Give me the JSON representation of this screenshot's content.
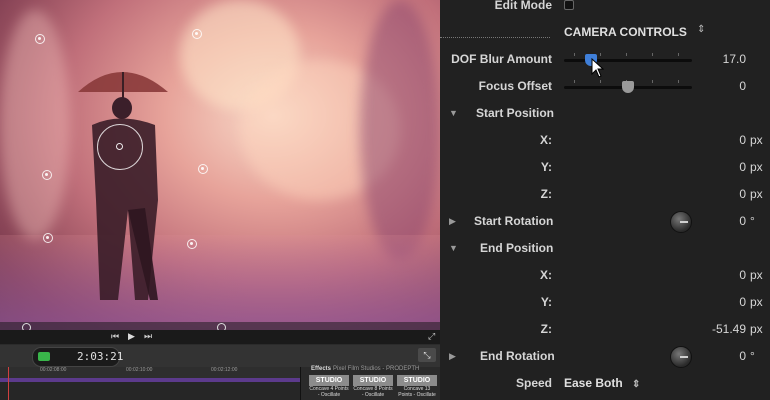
{
  "panel": {
    "edit_mode_label": "Edit Mode",
    "section_title": "CAMERA CONTROLS",
    "dof_blur_label": "DOF Blur Amount",
    "dof_blur_value": "17.0",
    "dof_blur_level": 0.18,
    "focus_offset_label": "Focus Offset",
    "focus_offset_value": "0",
    "focus_offset_level": 0.5,
    "start_position_label": "Start Position",
    "start_x_label": "X:",
    "start_x_value": "0",
    "start_x_unit": "px",
    "start_y_label": "Y:",
    "start_y_value": "0",
    "start_y_unit": "px",
    "start_z_label": "Z:",
    "start_z_value": "0",
    "start_z_unit": "px",
    "start_rotation_label": "Start Rotation",
    "start_rotation_value": "0",
    "start_rotation_unit": "°",
    "end_position_label": "End Position",
    "end_x_label": "X:",
    "end_x_value": "0",
    "end_x_unit": "px",
    "end_y_label": "Y:",
    "end_y_value": "0",
    "end_y_unit": "px",
    "end_z_label": "Z:",
    "end_z_value": "-51.49",
    "end_z_unit": "px",
    "end_rotation_label": "End Rotation",
    "end_rotation_value": "0",
    "end_rotation_unit": "°",
    "speed_label": "Speed",
    "speed_value": "Ease Both"
  },
  "timeline": {
    "timecode": "2:03:21",
    "ruler_labels": [
      "00:02:08:00",
      "00:02:10:00",
      "00:02:12:00"
    ]
  },
  "effects": {
    "tab_label": "Effects",
    "breadcrumb": "Pixel Film Studios - PRODEPTH",
    "thumb_text": "STUDIO",
    "items": [
      "Concave 4 Points - Oscillate",
      "Concave 8 Points - Oscillate",
      "Concave 13 Points - Oscillate"
    ]
  },
  "colors": {
    "accent_blue": "#3f7fd9",
    "panel_bg": "#212121",
    "timecode_green": "#39b54a"
  }
}
